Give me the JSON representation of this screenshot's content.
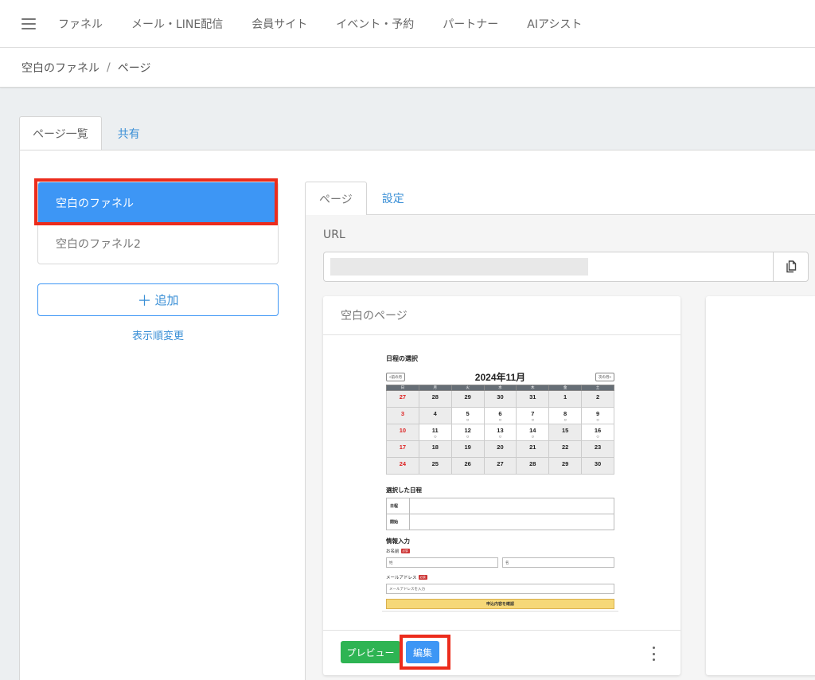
{
  "nav": {
    "items": [
      "ファネル",
      "メール・LINE配信",
      "会員サイト",
      "イベント・予約",
      "パートナー",
      "AIアシスト"
    ]
  },
  "breadcrumb": {
    "root": "空白のファネル",
    "separator": "/",
    "current": "ページ"
  },
  "outer_tabs": {
    "list": "ページ一覧",
    "share": "共有"
  },
  "funnels": [
    "空白のファネル",
    "空白のファネル2"
  ],
  "add_label": "追加",
  "reorder_label": "表示順変更",
  "inner_tabs": {
    "page": "ページ",
    "settings": "設定"
  },
  "url_label": "URL",
  "card": {
    "title": "空白のページ"
  },
  "buttons": {
    "preview": "プレビュー",
    "edit": "編集"
  },
  "colors": {
    "primary": "#3d96f5",
    "success": "#2eb453",
    "highlight": "#ec2c1c"
  },
  "thumbnail": {
    "title": "日程の選択",
    "prev_month": "<前の月",
    "next_month": "次の月>",
    "month": "2024年11月",
    "weekdays": [
      "日",
      "月",
      "火",
      "水",
      "木",
      "金",
      "土"
    ],
    "weeks": [
      [
        "27",
        "28",
        "29",
        "30",
        "31",
        "1",
        "2"
      ],
      [
        "3",
        "4",
        "5",
        "6",
        "7",
        "8",
        "9"
      ],
      [
        "10",
        "11",
        "12",
        "13",
        "14",
        "15",
        "16"
      ],
      [
        "17",
        "18",
        "19",
        "20",
        "21",
        "22",
        "23"
      ],
      [
        "24",
        "25",
        "26",
        "27",
        "28",
        "29",
        "30"
      ]
    ],
    "available_mark": "○",
    "selected_title": "選択した日程",
    "sel_date_label": "日程",
    "sel_time_label": "開始",
    "info_title": "情報入力",
    "name_label": "お名前",
    "required_badge": "必須",
    "last_name_placeholder": "姓",
    "first_name_placeholder": "名",
    "email_label": "メールアドレス",
    "email_placeholder": "メールアドレスを入力",
    "submit_label": "申込内容を確認"
  }
}
